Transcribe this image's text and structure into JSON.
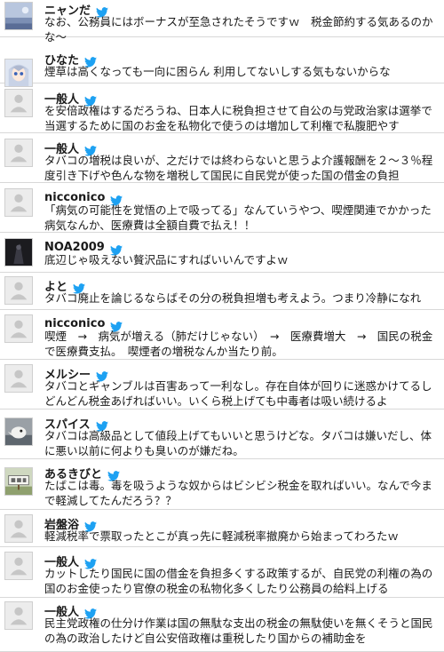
{
  "tweets": [
    {
      "name": "ニャンだ",
      "avatar": "landscape",
      "text": "なお、公務員にはボーナスが至急されたそうですｗ　税金節約する気あるのかな～"
    },
    {
      "name": "ひなた",
      "avatar": "anime",
      "text": "煙草は高くなっても一向に困らん 利用してないしする気もないからな"
    },
    {
      "name": "一般人",
      "avatar": "noimage",
      "text": "を安倍政権はするだろうね、日本人に税負担させて自公の与党政治家は選挙で当選するために国のお金を私物化で使うのは増加して利権で私腹肥やす"
    },
    {
      "name": "一般人",
      "avatar": "noimage",
      "text": "タバコの増税は良いが、之だけでは終わらないと思うよ介護報酬を２～３％程度引き下げや色んな物を増税して国民に自民党が使った国の借金の負担"
    },
    {
      "name": "nicconico",
      "avatar": "noimage",
      "text": "「病気の可能性を覚悟の上で吸ってる」なんていうやつ、喫煙関連でかかった病気なんか、医療費は全額自費で払え！！"
    },
    {
      "name": "NOA2009",
      "avatar": "dark",
      "text": "底辺じゃ吸えない贅沢品にすればいいんですよｗ"
    },
    {
      "name": "よと",
      "avatar": "noimage",
      "text": "タバコ廃止を論じるならばその分の税負担増も考えよう。つまり冷静になれ"
    },
    {
      "name": "nicconico",
      "avatar": "noimage",
      "text": "喫煙　→　病気が増える（肺だけじゃない）　→　医療費増大　→　国民の税金で医療費支払。　喫煙者の増税なんか当たり前。"
    },
    {
      "name": "メルシー",
      "avatar": "noimage",
      "text": "タバコとギャンブルは百害あって一利なし。存在自体が回りに迷惑かけてるしどんどん税金あげればいい。いくら税上げても中毒者は吸い続けるよ"
    },
    {
      "name": "スパイス",
      "avatar": "bird",
      "text": "タバコは高級品として値段上げてもいいと思うけどな。タバコは嫌いだし、体に悪い以前に何よりも臭いのが嫌だね。"
    },
    {
      "name": "あるきびと",
      "avatar": "sign",
      "text": "たばこは毒。毒を吸うような奴からはビシビシ税金を取ればいい。なんで今まで軽減してたんだろう？？"
    },
    {
      "name": "岩盤浴",
      "avatar": "noimage",
      "text": "軽減税率で票取ったとこが真っ先に軽減税率撤廃から始まってわろたｗ"
    },
    {
      "name": "一般人",
      "avatar": "noimage",
      "text": "カットしたり国民に国の借金を負担多くする政策するが、自民党の利権の為の国のお金使ったり官僚の税金の私物化多くしたり公務員の給料上げる"
    },
    {
      "name": "一般人",
      "avatar": "noimage",
      "text": "民主党政権の仕分け作業は国の無駄な支出の税金の無駄使いを無くそうと国民の為の政治したけど自公安倍政権は重税したり国からの補助金を"
    }
  ]
}
